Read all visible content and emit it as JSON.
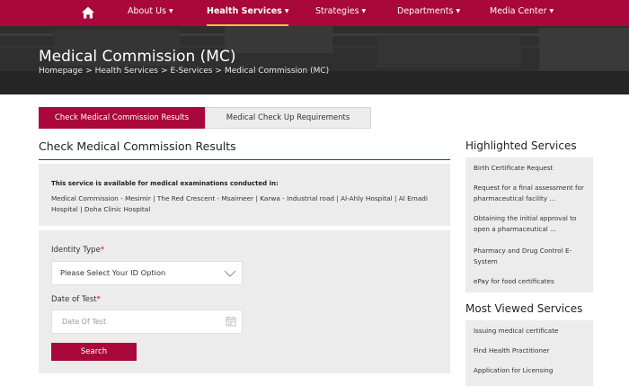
{
  "nav": {
    "items": [
      {
        "label": "About Us"
      },
      {
        "label": "Health Services"
      },
      {
        "label": "Strategies"
      },
      {
        "label": "Departments"
      },
      {
        "label": "Media Center"
      }
    ],
    "caret": "▼",
    "active_index": 1,
    "accent_color": "#a8083a",
    "home_icon": "home-icon"
  },
  "hero": {
    "title": "Medical Commission (MC)",
    "breadcrumb": [
      "Homepage",
      "Health Services",
      "E-Services",
      "Medical Commission (MC)"
    ],
    "separator": ">"
  },
  "tabs": [
    {
      "label": "Check Medical Commission Results",
      "selected": true
    },
    {
      "label": "Medical Check Up Requirements",
      "selected": false
    }
  ],
  "main": {
    "title": "Check Medical Commission Results",
    "info_heading": "This service is available for medical examinations conducted in:",
    "info_text": "Medical Commission - Mesimir | The Red Crescent - Msaimeer | Karwa - Industrial road | Al-Ahly Hospital | Al Emadi Hospital | Doha Clinic Hospital"
  },
  "form": {
    "identity_label": "Identity Type",
    "identity_value": "Please Select Your ID Option",
    "date_label": "Date of Test",
    "date_placeholder": "Date Of Test",
    "required_mark": "*",
    "search_label": "Search"
  },
  "sidebar": {
    "highlighted_title": "Highlighted Services",
    "highlighted": [
      {
        "label": "Birth Certificate Request"
      },
      {
        "label": "Request for a final assessment for pharmaceutical facility ..."
      },
      {
        "label": "Obtaining the initial approval to open a pharmaceutical ..."
      },
      {
        "label": "Pharmacy and Drug Control E-System"
      },
      {
        "label": "ePay for food certificates"
      }
    ],
    "most_viewed_title": "Most Viewed Services",
    "most_viewed": [
      {
        "label": "Issuing medical certificate"
      },
      {
        "label": "Find Health Practitioner"
      },
      {
        "label": "Application for Licensing"
      }
    ]
  }
}
